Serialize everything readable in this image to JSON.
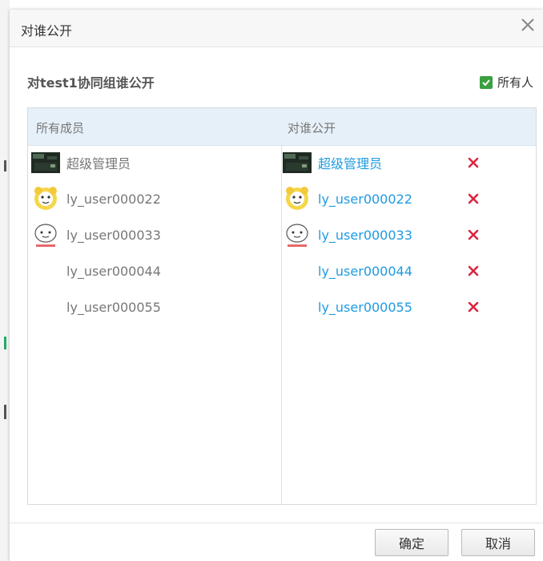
{
  "dialog": {
    "title": "对谁公开"
  },
  "section": {
    "title": "对test1协同组谁公开"
  },
  "all_check": {
    "label": "所有人",
    "checked": true
  },
  "left_column": {
    "header": "所有成员",
    "members": [
      {
        "name": "超级管理员",
        "avatar": "dark-photo"
      },
      {
        "name": "ly_user000022",
        "avatar": "cartoon-yellow"
      },
      {
        "name": "ly_user000033",
        "avatar": "cartoon-white"
      },
      {
        "name": "ly_user000044",
        "avatar": "none"
      },
      {
        "name": "ly_user000055",
        "avatar": "none"
      }
    ]
  },
  "right_column": {
    "header": "对谁公开",
    "members": [
      {
        "name": "超级管理员",
        "avatar": "dark-photo"
      },
      {
        "name": "ly_user000022",
        "avatar": "cartoon-yellow"
      },
      {
        "name": "ly_user000033",
        "avatar": "cartoon-white"
      },
      {
        "name": "ly_user000044",
        "avatar": "none"
      },
      {
        "name": "ly_user000055",
        "avatar": "none"
      }
    ]
  },
  "buttons": {
    "confirm": "确定",
    "cancel": "取消"
  },
  "colors": {
    "link": "#1e9be0",
    "remove": "#e0243f",
    "check": "#3aa040",
    "header_bg": "#e6f0f8"
  },
  "icons": {
    "close": "close-icon",
    "remove": "remove-x-icon",
    "check": "check-icon"
  }
}
